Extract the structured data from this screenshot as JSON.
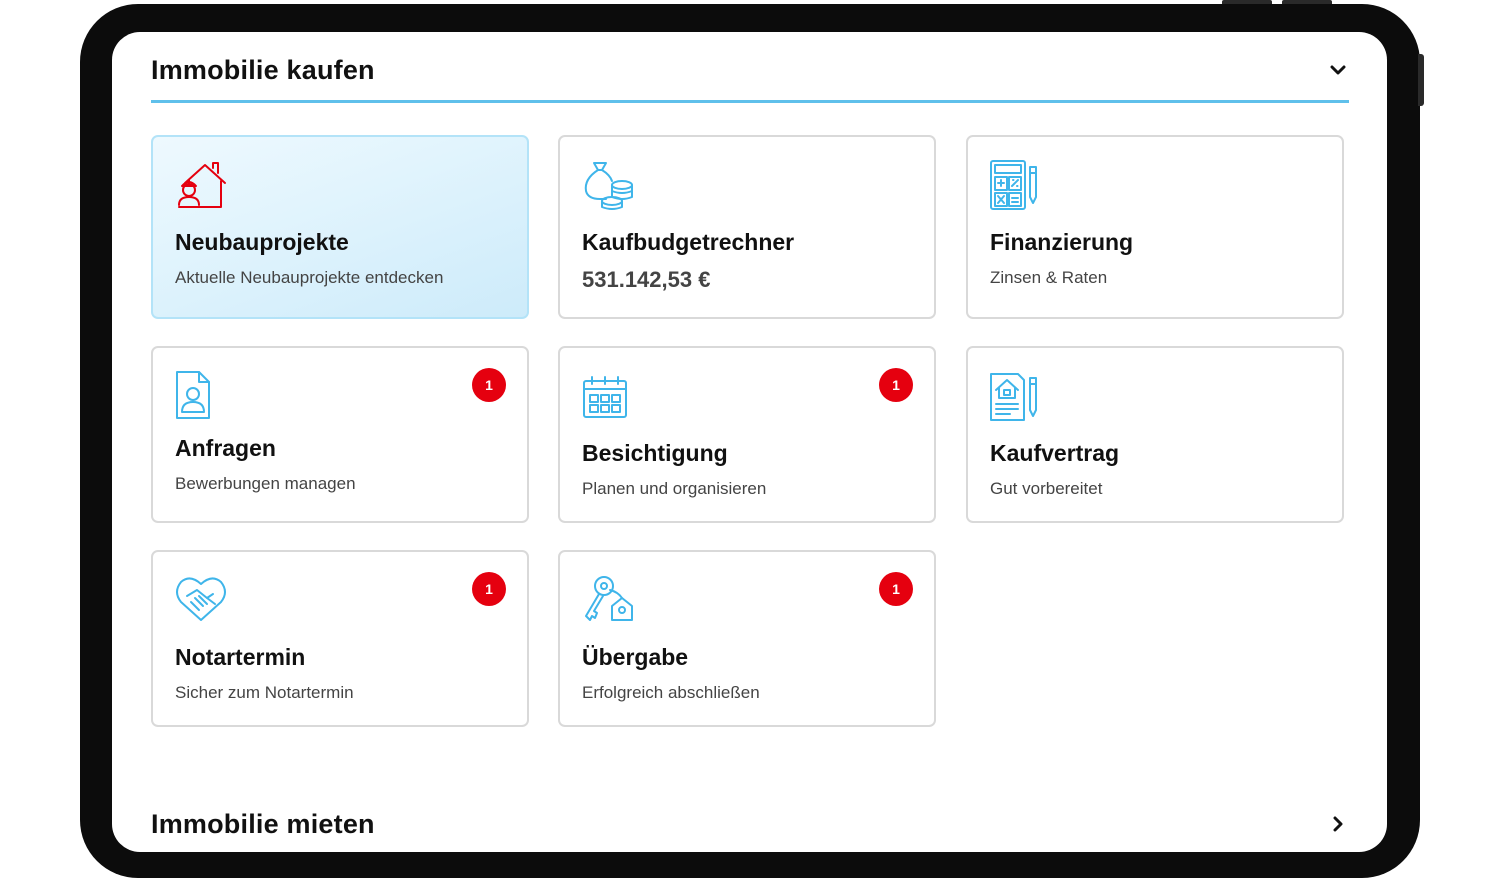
{
  "sections": {
    "buy": {
      "title": "Immobilie kaufen",
      "chevron_icon": "chevron-down-icon"
    },
    "rent": {
      "title": "Immobilie mieten",
      "chevron_icon": "chevron-right-icon"
    }
  },
  "tiles": [
    {
      "id": "neubauprojekte",
      "title": "Neubauprojekte",
      "subtitle": "Aktuelle Neubauprojekte entdecken",
      "icon": "house-builder-icon",
      "active": true
    },
    {
      "id": "kaufbudgetrechner",
      "title": "Kaufbudgetrechner",
      "value": "531.142,53 €",
      "icon": "money-bag-coins-icon"
    },
    {
      "id": "finanzierung",
      "title": "Finanzierung",
      "subtitle": "Zinsen & Raten",
      "icon": "calculator-pen-icon"
    },
    {
      "id": "anfragen",
      "title": "Anfragen",
      "subtitle": "Bewerbungen managen",
      "icon": "profile-document-icon",
      "badge": "1"
    },
    {
      "id": "besichtigung",
      "title": "Besichtigung",
      "subtitle": "Planen und organisieren",
      "icon": "calendar-icon",
      "badge": "1"
    },
    {
      "id": "kaufvertrag",
      "title": "Kaufvertrag",
      "subtitle": "Gut vorbereitet",
      "icon": "contract-house-pen-icon"
    },
    {
      "id": "notartermin",
      "title": "Notartermin",
      "subtitle": "Sicher zum Notartermin",
      "icon": "handshake-heart-icon",
      "badge": "1"
    },
    {
      "id": "uebergabe",
      "title": "Übergabe",
      "subtitle": "Erfolgreich abschließen",
      "icon": "keys-house-icon",
      "badge": "1"
    }
  ],
  "colors": {
    "accent": "#5fc0eb",
    "icon_blue": "#3fb5ea",
    "icon_red": "#e5000f",
    "badge": "#e5000f",
    "active_tile": "#d9f0fc"
  }
}
